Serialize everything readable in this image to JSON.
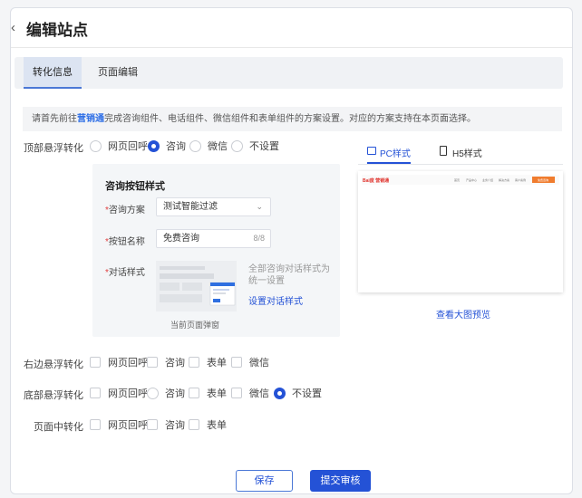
{
  "header": {
    "title": "编辑站点"
  },
  "tabs": [
    {
      "label": "转化信息",
      "active": true
    },
    {
      "label": "页面编辑",
      "active": false
    }
  ],
  "notice": {
    "prefix": "请首先前往",
    "link": "营销通",
    "suffix": "完成咨询组件、电话组件、微信组件和表单组件的方案设置。对应的方案支持在本页面选择。"
  },
  "top_float": {
    "label": "顶部悬浮转化",
    "options": [
      {
        "label": "网页回呼",
        "selected": false
      },
      {
        "label": "咨询",
        "selected": true
      },
      {
        "label": "微信",
        "selected": false
      },
      {
        "label": "不设置",
        "selected": false
      }
    ]
  },
  "consult_panel": {
    "title": "咨询按钮样式",
    "scheme_label": "咨询方案",
    "scheme_value": "测试智能过滤",
    "name_label": "按钮名称",
    "name_value": "免费咨询",
    "name_counter": "8/8",
    "dialog_label": "对话样式",
    "dialog_desc": "全部咨询对话样式为统一设置",
    "dialog_link": "设置对话样式",
    "thumb_caption": "当前页面弹窗"
  },
  "preview": {
    "tabs": [
      {
        "label": "PC样式",
        "active": true
      },
      {
        "label": "H5样式",
        "active": false
      }
    ],
    "logo_text": "Bai度 营销通",
    "nav_items": [
      "首页",
      "产品中心",
      "业务介绍",
      "解决方案",
      "客户案例"
    ],
    "cta_label": "免费咨询",
    "big_preview": "查看大图预览"
  },
  "right_float": {
    "label": "右边悬浮转化",
    "options": [
      {
        "label": "网页回呼",
        "checked": false
      },
      {
        "label": "咨询",
        "checked": false
      },
      {
        "label": "表单",
        "checked": false
      },
      {
        "label": "微信",
        "checked": false
      }
    ]
  },
  "bottom_float": {
    "label": "底部悬浮转化",
    "options": [
      {
        "label": "网页回呼",
        "type": "check",
        "selected": false
      },
      {
        "label": "咨询",
        "type": "radio",
        "selected": false
      },
      {
        "label": "表单",
        "type": "check",
        "selected": false
      },
      {
        "label": "微信",
        "type": "check",
        "selected": false
      },
      {
        "label": "不设置",
        "type": "radio",
        "selected": true
      }
    ]
  },
  "mid_page": {
    "label": "页面中转化",
    "options": [
      {
        "label": "网页回呼",
        "checked": false
      },
      {
        "label": "咨询",
        "checked": false
      },
      {
        "label": "表单",
        "checked": false
      }
    ]
  },
  "actions": {
    "save": "保存",
    "submit": "提交审核"
  },
  "colors": {
    "accent": "#2452d6",
    "required": "#e04040",
    "cta": "#f07c2e"
  }
}
